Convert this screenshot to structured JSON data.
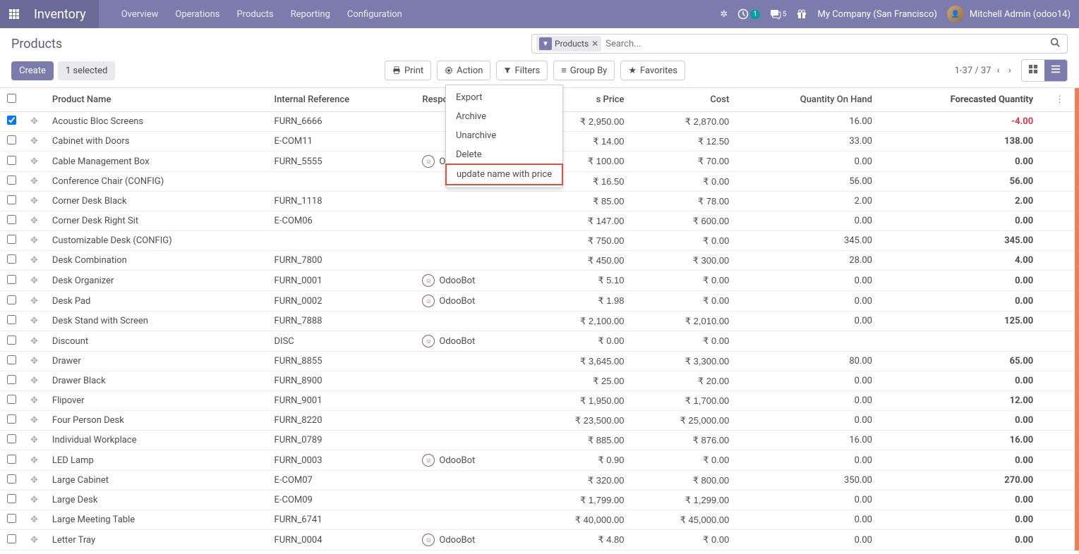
{
  "nav": {
    "brand": "Inventory",
    "menu": [
      "Overview",
      "Operations",
      "Products",
      "Reporting",
      "Configuration"
    ],
    "notif_count": "1",
    "msg_count": "5",
    "company": "My Company (San Francisco)",
    "user": "Mitchell Admin (odoo14)"
  },
  "cp": {
    "breadcrumb": "Products",
    "search_facet": "Products",
    "search_placeholder": "Search...",
    "create": "Create",
    "selected": "1 selected",
    "print": "Print",
    "action": "Action",
    "filters": "Filters",
    "groupby": "Group By",
    "favorites": "Favorites",
    "pager": "1-37 / 37"
  },
  "action_menu": {
    "items": [
      "Export",
      "Archive",
      "Unarchive",
      "Delete",
      "update name with price"
    ],
    "highlighted_index": 4
  },
  "table": {
    "headers": {
      "name": "Product Name",
      "ref": "Internal Reference",
      "responsible": "Responsible",
      "sales_price_partial": "s Price",
      "cost": "Cost",
      "qty_on_hand": "Quantity On Hand",
      "forecasted": "Forecasted Quantity"
    },
    "rows": [
      {
        "checked": true,
        "name": "Acoustic Bloc Screens",
        "ref": "FURN_6666",
        "responsible": "",
        "price": "₹ 2,950.00",
        "cost": "₹ 2,870.00",
        "qty": "16.00",
        "forecast": "-4.00",
        "neg": true
      },
      {
        "name": "Cabinet with Doors",
        "ref": "E-COM11",
        "responsible": "",
        "price": "₹ 14.00",
        "cost": "₹ 12.50",
        "qty": "33.00",
        "forecast": "138.00"
      },
      {
        "name": "Cable Management Box",
        "ref": "FURN_5555",
        "responsible": "OdooBot",
        "resp_cut": true,
        "price": "₹ 100.00",
        "cost": "₹ 70.00",
        "qty": "0.00",
        "forecast": "0.00"
      },
      {
        "name": "Conference Chair (CONFIG)",
        "ref": "",
        "responsible": "",
        "price": "₹ 16.50",
        "cost": "₹ 0.00",
        "qty": "56.00",
        "forecast": "56.00"
      },
      {
        "name": "Corner Desk Black",
        "ref": "FURN_1118",
        "responsible": "",
        "price": "₹ 85.00",
        "cost": "₹ 78.00",
        "qty": "2.00",
        "forecast": "2.00"
      },
      {
        "name": "Corner Desk Right Sit",
        "ref": "E-COM06",
        "responsible": "",
        "price": "₹ 147.00",
        "cost": "₹ 600.00",
        "qty": "0.00",
        "forecast": "0.00"
      },
      {
        "name": "Customizable Desk (CONFIG)",
        "ref": "",
        "responsible": "",
        "price": "₹ 750.00",
        "cost": "₹ 0.00",
        "qty": "345.00",
        "forecast": "345.00"
      },
      {
        "name": "Desk Combination",
        "ref": "FURN_7800",
        "responsible": "",
        "price": "₹ 450.00",
        "cost": "₹ 300.00",
        "qty": "28.00",
        "forecast": "4.00"
      },
      {
        "name": "Desk Organizer",
        "ref": "FURN_0001",
        "responsible": "OdooBot",
        "price": "₹ 5.10",
        "cost": "₹ 0.00",
        "qty": "0.00",
        "forecast": "0.00"
      },
      {
        "name": "Desk Pad",
        "ref": "FURN_0002",
        "responsible": "OdooBot",
        "price": "₹ 1.98",
        "cost": "₹ 0.00",
        "qty": "0.00",
        "forecast": "0.00"
      },
      {
        "name": "Desk Stand with Screen",
        "ref": "FURN_7888",
        "responsible": "",
        "price": "₹ 2,100.00",
        "cost": "₹ 2,010.00",
        "qty": "0.00",
        "forecast": "125.00"
      },
      {
        "name": "Discount",
        "ref": "DISC",
        "responsible": "OdooBot",
        "price": "₹ 0.00",
        "cost": "₹ 0.00",
        "qty": "",
        "forecast": ""
      },
      {
        "name": "Drawer",
        "ref": "FURN_8855",
        "responsible": "",
        "price": "₹ 3,645.00",
        "cost": "₹ 3,300.00",
        "qty": "80.00",
        "forecast": "65.00"
      },
      {
        "name": "Drawer Black",
        "ref": "FURN_8900",
        "responsible": "",
        "price": "₹ 25.00",
        "cost": "₹ 20.00",
        "qty": "0.00",
        "forecast": "0.00"
      },
      {
        "name": "Flipover",
        "ref": "FURN_9001",
        "responsible": "",
        "price": "₹ 1,950.00",
        "cost": "₹ 1,700.00",
        "qty": "0.00",
        "forecast": "12.00"
      },
      {
        "name": "Four Person Desk",
        "ref": "FURN_8220",
        "responsible": "",
        "price": "₹ 23,500.00",
        "cost": "₹ 25,000.00",
        "qty": "0.00",
        "forecast": "0.00"
      },
      {
        "name": "Individual Workplace",
        "ref": "FURN_0789",
        "responsible": "",
        "price": "₹ 885.00",
        "cost": "₹ 876.00",
        "qty": "16.00",
        "forecast": "16.00"
      },
      {
        "name": "LED Lamp",
        "ref": "FURN_0003",
        "responsible": "OdooBot",
        "price": "₹ 0.90",
        "cost": "₹ 0.00",
        "qty": "0.00",
        "forecast": "0.00"
      },
      {
        "name": "Large Cabinet",
        "ref": "E-COM07",
        "responsible": "",
        "price": "₹ 320.00",
        "cost": "₹ 800.00",
        "qty": "350.00",
        "forecast": "270.00"
      },
      {
        "name": "Large Desk",
        "ref": "E-COM09",
        "responsible": "",
        "price": "₹ 1,799.00",
        "cost": "₹ 1,299.00",
        "qty": "0.00",
        "forecast": "0.00"
      },
      {
        "name": "Large Meeting Table",
        "ref": "FURN_6741",
        "responsible": "",
        "price": "₹ 40,000.00",
        "cost": "₹ 45,000.00",
        "qty": "0.00",
        "forecast": "0.00"
      },
      {
        "name": "Letter Tray",
        "ref": "FURN_0004",
        "responsible": "OdooBot",
        "price": "₹ 4.80",
        "cost": "₹ 0.00",
        "qty": "0.00",
        "forecast": "0.00"
      }
    ]
  }
}
